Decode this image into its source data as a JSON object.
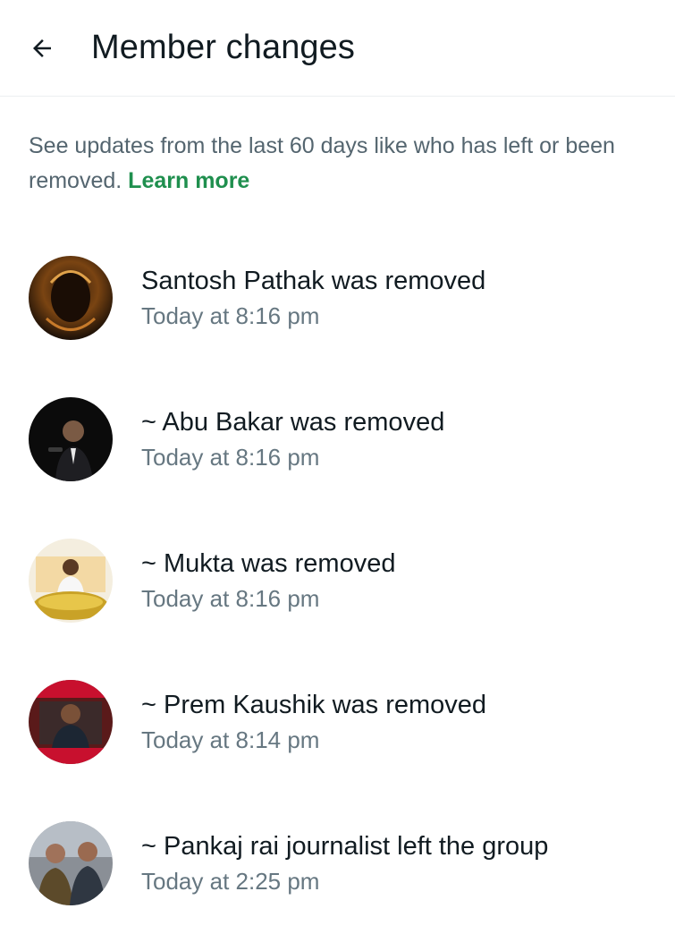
{
  "header": {
    "title": "Member changes",
    "back_icon": "arrow-left-icon"
  },
  "info": {
    "text": "See updates from the last 60 days like who has left or been removed.",
    "link": "Learn more",
    "link_color": "#1f8f4e"
  },
  "items": [
    {
      "event": "Santosh Pathak was removed",
      "time": "Today at 8:16 pm"
    },
    {
      "event": "~ Abu Bakar was removed",
      "time": "Today at 8:16 pm"
    },
    {
      "event": "~ Mukta was removed",
      "time": "Today at 8:16 pm"
    },
    {
      "event": "~ Prem Kaushik was removed",
      "time": "Today at 8:14 pm"
    },
    {
      "event": "~ Pankaj rai journalist left the group",
      "time": "Today at 2:25 pm"
    }
  ]
}
